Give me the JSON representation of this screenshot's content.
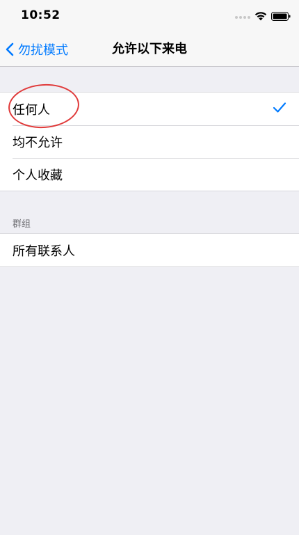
{
  "status_bar": {
    "time": "10:52",
    "icons": [
      "signal-dots-icon",
      "wifi-icon",
      "battery-icon"
    ]
  },
  "nav": {
    "back_label": "勿扰模式",
    "title": "允许以下来电"
  },
  "options": {
    "items": [
      {
        "label": "任何人",
        "selected": true
      },
      {
        "label": "均不允许",
        "selected": false
      },
      {
        "label": "个人收藏",
        "selected": false
      }
    ]
  },
  "groups_section": {
    "header": "群组",
    "items": [
      {
        "label": "所有联系人",
        "selected": false
      }
    ]
  },
  "colors": {
    "accent": "#007aff",
    "annotation": "#e03a3a",
    "background": "#efeff4"
  }
}
